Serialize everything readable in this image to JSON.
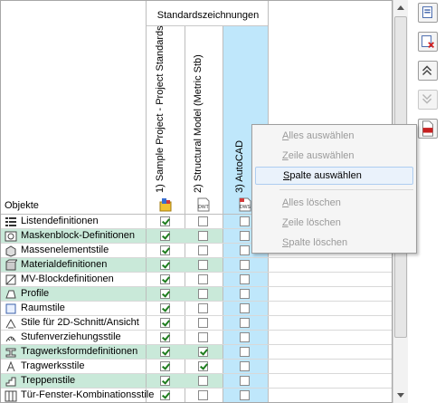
{
  "matrix": {
    "group_header": "Standardszeichnungen",
    "objects_label": "Objekte",
    "columns": [
      {
        "label": "1) Sample Project - Project Standards",
        "icon": "project-icon"
      },
      {
        "label": "2) Structural Model (Metric Stb)",
        "icon": "dwt-file-icon",
        "icon_text": "DWT"
      },
      {
        "label": "3) AutoCAD",
        "icon": "dws-file-icon",
        "icon_text": "DWS"
      }
    ],
    "rows": [
      {
        "label": "Listendefinitionen",
        "icon": "list-definition-icon",
        "highlight": false,
        "checks": [
          true,
          false,
          false
        ]
      },
      {
        "label": "Maskenblock-Definitionen",
        "icon": "mask-block-icon",
        "highlight": true,
        "checks": [
          true,
          false,
          false
        ]
      },
      {
        "label": "Massenelementstile",
        "icon": "mass-element-icon",
        "highlight": false,
        "checks": [
          true,
          false,
          false
        ]
      },
      {
        "label": "Materialdefinitionen",
        "icon": "material-icon",
        "highlight": true,
        "checks": [
          true,
          false,
          false
        ]
      },
      {
        "label": "MV-Blockdefinitionen",
        "icon": "mv-block-icon",
        "highlight": false,
        "checks": [
          true,
          false,
          false
        ]
      },
      {
        "label": "Profile",
        "icon": "profile-icon",
        "highlight": true,
        "checks": [
          true,
          false,
          false
        ]
      },
      {
        "label": "Raumstile",
        "icon": "space-style-icon",
        "highlight": false,
        "checks": [
          true,
          false,
          false
        ]
      },
      {
        "label": "Stile für 2D-Schnitt/Ansicht",
        "icon": "section-elevation-icon",
        "highlight": false,
        "checks": [
          true,
          false,
          false
        ]
      },
      {
        "label": "Stufenverziehungsstile",
        "icon": "stair-winder-icon",
        "highlight": false,
        "checks": [
          true,
          false,
          false
        ]
      },
      {
        "label": "Tragwerksformdefinitionen",
        "icon": "member-shape-icon",
        "highlight": true,
        "checks": [
          true,
          true,
          false
        ]
      },
      {
        "label": "Tragwerksstile",
        "icon": "member-style-icon",
        "highlight": false,
        "checks": [
          true,
          true,
          false
        ]
      },
      {
        "label": "Treppenstile",
        "icon": "stair-style-icon",
        "highlight": true,
        "checks": [
          true,
          false,
          false
        ]
      },
      {
        "label": "Tür-Fenster-Kombinationsstile",
        "icon": "door-window-assembly-icon",
        "highlight": false,
        "checks": [
          true,
          false,
          false
        ]
      }
    ]
  },
  "context_menu": {
    "items": [
      {
        "label": "Alles auswählen",
        "mnemonic": "A",
        "enabled": false
      },
      {
        "label": "Zeile auswählen",
        "mnemonic": "Z",
        "enabled": false
      },
      {
        "label": "Spalte auswählen",
        "mnemonic": "S",
        "enabled": true,
        "highlighted": true
      },
      {
        "label": "Alles löschen",
        "mnemonic": "A",
        "enabled": false
      },
      {
        "label": "Zeile löschen",
        "mnemonic": "Z",
        "enabled": false
      },
      {
        "label": "Spalte löschen",
        "mnemonic": "S",
        "enabled": false
      }
    ]
  },
  "toolbar": {
    "buttons": [
      {
        "name": "add-drawing-button",
        "icon": "add-drawing-icon",
        "enabled": true
      },
      {
        "name": "remove-drawing-button",
        "icon": "remove-drawing-icon",
        "enabled": true
      },
      {
        "name": "move-up-button",
        "icon": "double-chevron-up-icon",
        "enabled": true
      },
      {
        "name": "move-down-button",
        "icon": "double-chevron-down-icon",
        "enabled": false
      },
      {
        "name": "pdf-report-button",
        "icon": "pdf-report-icon",
        "enabled": true
      }
    ]
  },
  "colors": {
    "row_highlight": "#c9e9d9",
    "selected_column": "#bfe7fb",
    "check": "#1e7d1e"
  }
}
